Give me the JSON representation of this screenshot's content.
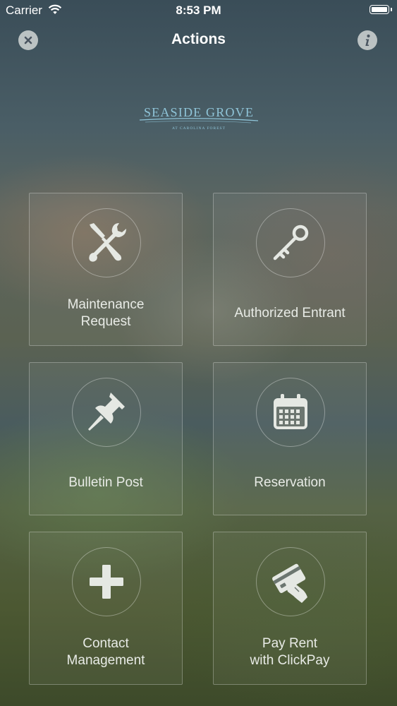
{
  "status_bar": {
    "carrier": "Carrier",
    "time": "8:53 PM"
  },
  "nav": {
    "title": "Actions"
  },
  "logo": {
    "name": "SEASIDE GROVE",
    "tagline": "AT CAROLINA FOREST"
  },
  "tiles": [
    {
      "label_line1": "Maintenance",
      "label_line2": "Request",
      "icon": "tools-icon"
    },
    {
      "label_line1": "Authorized Entrant",
      "label_line2": "",
      "icon": "key-icon"
    },
    {
      "label_line1": "Bulletin Post",
      "label_line2": "",
      "icon": "pushpin-icon"
    },
    {
      "label_line1": "Reservation",
      "label_line2": "",
      "icon": "calendar-icon"
    },
    {
      "label_line1": "Contact",
      "label_line2": "Management",
      "icon": "plus-icon"
    },
    {
      "label_line1": "Pay Rent",
      "label_line2": "with ClickPay",
      "icon": "credit-card-icon"
    }
  ],
  "colors": {
    "text": "#ffffff",
    "tile_border": "#d0d4cc",
    "icon": "#e5e8e3"
  }
}
